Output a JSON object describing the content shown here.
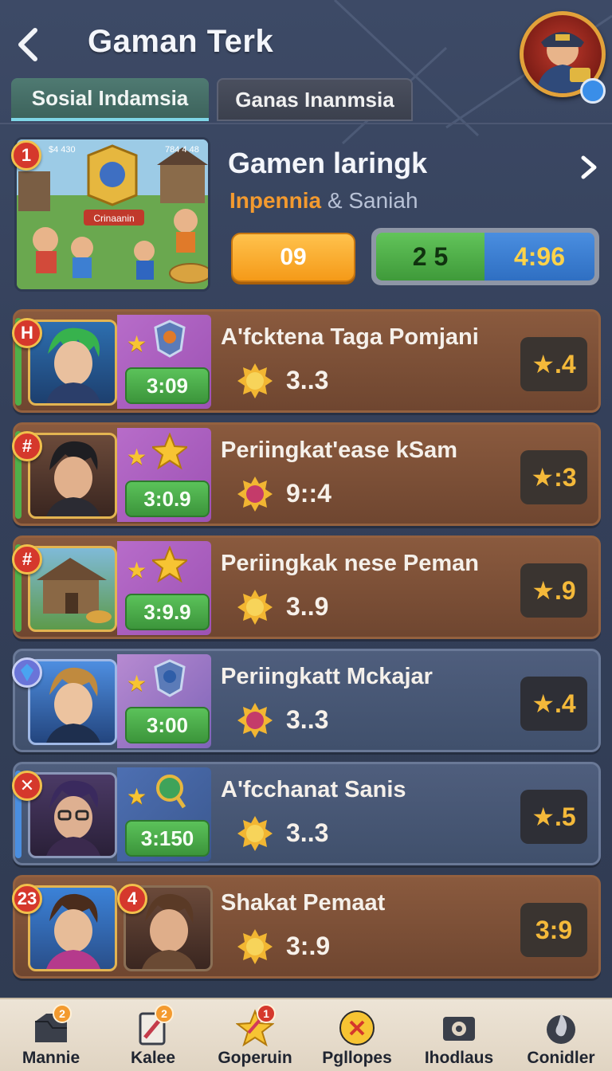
{
  "header": {
    "title": "Gaman Terk",
    "back_icon": "chevron-left-icon",
    "avatar_icon": "user-avatar-icon"
  },
  "tabs": [
    {
      "label": "Sosial Indamsia",
      "active": true
    },
    {
      "label": "Ganas Inanmsia",
      "active": false
    }
  ],
  "featured": {
    "rank": "1",
    "thumb_top_left": "$4 430",
    "thumb_top_right": "784 4 48",
    "thumb_banner": "Crinaanin",
    "title": "Gamen laringk",
    "subtitle_highlight": "Inpennia",
    "subtitle_rest": "& Saniah",
    "orange_value": "09",
    "green_value": "2 5",
    "blue_value": "4:96",
    "accent_orange": "#f59a18",
    "accent_green": "#4fb04a",
    "accent_blue": "#2f6fc2"
  },
  "rows": [
    {
      "badge": "H",
      "title": "A'fcktena Taga Pomjani",
      "timer": "3:09",
      "value": "3..3",
      "score": "★.4",
      "icon": "sun-icon",
      "theme": "brown"
    },
    {
      "badge": "#",
      "title": "Periingkat'ease kSam",
      "timer": "3:0.9",
      "value": "9::4",
      "score": "★:3",
      "icon": "gem-icon",
      "theme": "brown"
    },
    {
      "badge": "#",
      "title": "Periingkak nese Peman",
      "timer": "3:9.9",
      "value": "3..9",
      "score": "★.9",
      "icon": "sun-icon",
      "theme": "brown"
    },
    {
      "badge": "",
      "title": "Periingkatt Mckajar",
      "timer": "3:00",
      "value": "3..3",
      "score": "★.4",
      "icon": "gem-icon",
      "theme": "blue"
    },
    {
      "badge": "✕",
      "title": "A'fcchanat Sanis",
      "timer": "3:150",
      "value": "3..3",
      "score": "★.5",
      "icon": "sun-icon",
      "theme": "blue"
    },
    {
      "badge": "23",
      "badge2": "4",
      "title": "Shakat Pemaat",
      "value": "3:.9",
      "score": "3:9",
      "icon": "sun-icon",
      "theme": "brown"
    }
  ],
  "bottom_nav": [
    {
      "label": "Mannie",
      "icon": "folder-icon",
      "notif": "2"
    },
    {
      "label": "Kalee",
      "icon": "pencil-icon",
      "notif": "2"
    },
    {
      "label": "Goperuin",
      "icon": "star-icon",
      "notif": "1"
    },
    {
      "label": "Pgllopes",
      "icon": "close-circle-icon",
      "notif": ""
    },
    {
      "label": "Ihodlaus",
      "icon": "camera-icon",
      "notif": ""
    },
    {
      "label": "Conidler",
      "icon": "flame-icon",
      "notif": ""
    }
  ]
}
